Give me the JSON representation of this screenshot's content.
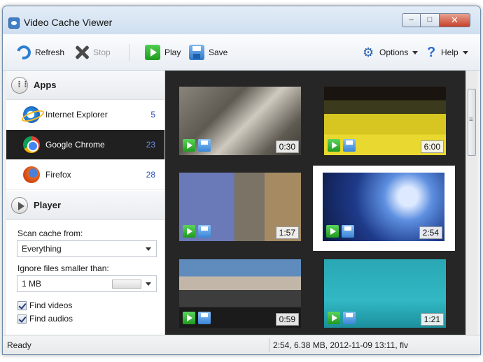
{
  "window": {
    "title": "Video Cache Viewer",
    "controls": {
      "minimize": "–",
      "maximize": "□",
      "close": "✕"
    }
  },
  "toolbar": {
    "refresh": "Refresh",
    "stop": "Stop",
    "play": "Play",
    "save": "Save",
    "options": "Options",
    "help": "Help"
  },
  "sidebar": {
    "apps_header": "Apps",
    "apps": [
      {
        "name": "Internet Explorer",
        "count": "5",
        "icon": "internet-explorer-icon"
      },
      {
        "name": "Google Chrome",
        "count": "23",
        "icon": "chrome-icon",
        "selected": true
      },
      {
        "name": "Firefox",
        "count": "28",
        "icon": "firefox-icon"
      }
    ],
    "player_header": "Player",
    "scan_label": "Scan cache from:",
    "scan_value": "Everything",
    "ignore_label": "Ignore files smaller than:",
    "ignore_value": "1 MB",
    "find_videos": "Find videos",
    "find_audios": "Find audios"
  },
  "gallery": {
    "videos": [
      {
        "duration": "0:30"
      },
      {
        "duration": "6:00"
      },
      {
        "duration": "1:57"
      },
      {
        "duration": "2:54",
        "selected": true
      },
      {
        "duration": "0:59"
      },
      {
        "duration": "1:21"
      }
    ]
  },
  "status": {
    "left": "Ready",
    "right": "2:54,  6.38 MB,  2012-11-09 13:11,  flv"
  },
  "colors": {
    "selected_row_bg": "#202020",
    "count_text": "#2a4eb3",
    "gallery_bg": "#262626",
    "accent_play": "#1e9c1e",
    "accent_save": "#2e78c9"
  }
}
